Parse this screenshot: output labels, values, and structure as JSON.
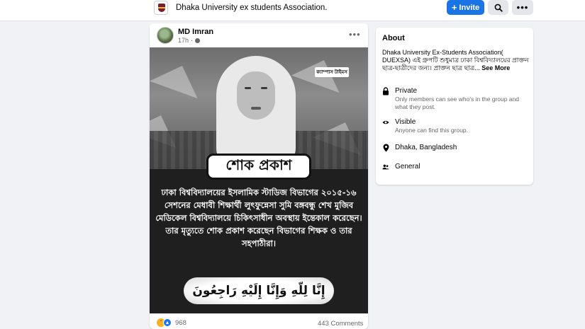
{
  "header": {
    "group_name": "Dhaka University ex students Association.",
    "invite_label": "Invite",
    "more_label": "•••"
  },
  "post": {
    "author": "MD Imran",
    "time": "17h",
    "menu_label": "•••",
    "image": {
      "watermark": "ক্যাম্পাস টাইমস",
      "banner": "শোক প্রকাশ",
      "caption": "ঢাকা বিশ্ববিদ্যালয়ের ইসলামিক স্টাডিজ বিভাগের ২০১৫-১৬ সেশনের মেধাবী শিক্ষার্থী লুৎফুন্নেসা সুমি বঙ্গবন্ধু শেখ মুজিব মেডিকেল বিশ্ববিদ্যালয়ে চিকিৎসাধীন অবস্থায় ইন্তেকাল করেছেন। তার মৃত্যুতে শোক প্রকাশ করেছেন বিভাগের শিক্ষক ও তার সহপাঠীরা।",
      "arabic": "إِنَّا لِلّهِ وَإِنَّا إِلَيْهِ رَاجِعُونَ"
    },
    "reaction_count": "968",
    "comments": "443 Comments"
  },
  "about": {
    "title": "About",
    "description": "Dhaka University Ex-Students Association( DUEXSA) এই গ্রুপটি শুধুমাত্র ঢাকা বিশ্ববিদ্যালয়ের প্রাক্তন ছাত্র-ছাত্রীদের জন্য। প্রাক্তন ছাত্র ছাত্র...",
    "see_more": "See More",
    "privacy_label": "Private",
    "privacy_desc": "Only members can see who's in the group and what they post.",
    "visibility_label": "Visible",
    "visibility_desc": "Anyone can find this group.",
    "location": "Dhaka, Bangladesh",
    "category": "General"
  }
}
